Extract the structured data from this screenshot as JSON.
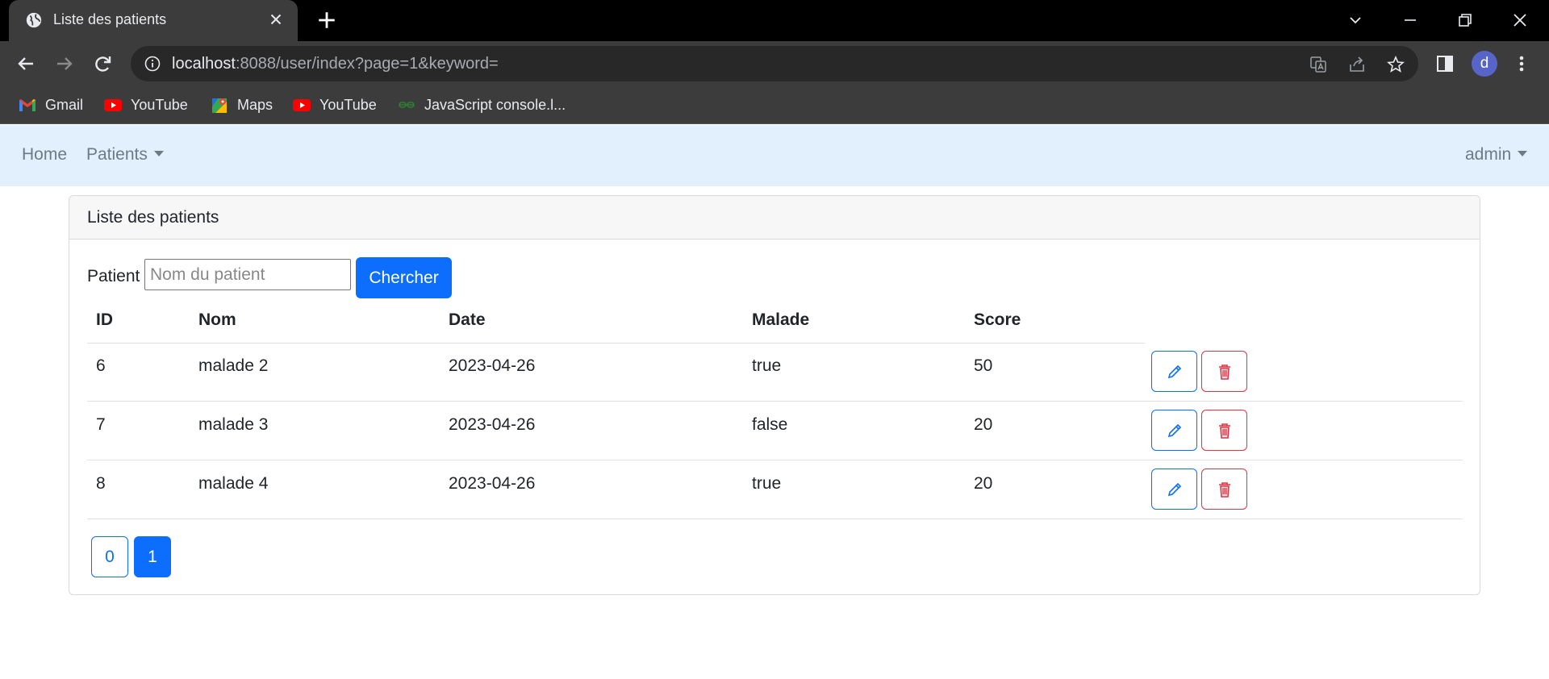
{
  "browser": {
    "tab_title": "Liste des patients",
    "url_host": "localhost",
    "url_rest": ":8088/user/index?page=1&keyword=",
    "profile_letter": "d",
    "bookmarks": [
      {
        "label": "Gmail",
        "icon": "gmail-icon"
      },
      {
        "label": "YouTube",
        "icon": "youtube-icon"
      },
      {
        "label": "Maps",
        "icon": "maps-icon"
      },
      {
        "label": "YouTube",
        "icon": "youtube-icon"
      },
      {
        "label": "JavaScript console.l...",
        "icon": "link-icon"
      }
    ]
  },
  "navbar": {
    "home": "Home",
    "patients": "Patients",
    "user": "admin"
  },
  "card": {
    "title": "Liste des patients",
    "search_label": "Patient",
    "search_placeholder": "Nom du patient",
    "search_value": "",
    "search_button": "Chercher"
  },
  "table": {
    "columns": [
      "ID",
      "Nom",
      "Date",
      "Malade",
      "Score"
    ],
    "rows": [
      [
        "6",
        "malade 2",
        "2023-04-26",
        "true",
        "50"
      ],
      [
        "7",
        "malade 3",
        "2023-04-26",
        "false",
        "20"
      ],
      [
        "8",
        "malade 4",
        "2023-04-26",
        "true",
        "20"
      ]
    ]
  },
  "pagination": {
    "pages": [
      "0",
      "1"
    ],
    "current": "1"
  },
  "colors": {
    "primary": "#0d6efd",
    "danger": "#dc3545",
    "navbar_bg": "#e2effd"
  }
}
